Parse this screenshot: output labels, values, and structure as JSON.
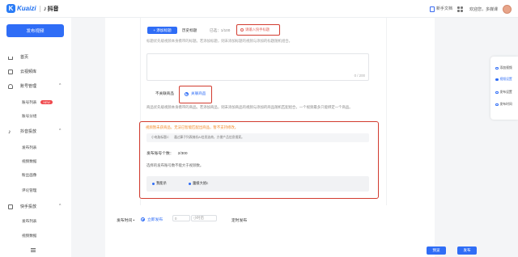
{
  "topbar": {
    "logo_text": "Kuaizi",
    "douyin_text": "抖音",
    "docs_label": "新手文档",
    "welcome_text": "欢迎您，多媒课"
  },
  "sidebar": {
    "publish_button": "发布视频",
    "items": [
      {
        "label": "首页",
        "icon": "home-icon"
      },
      {
        "label": "云视频库",
        "icon": "cloud-icon"
      },
      {
        "label": "账号管理",
        "icon": "user-icon",
        "sub": [
          {
            "label": "账号列表",
            "badge": "NEW"
          },
          {
            "label": "账号分组"
          }
        ]
      },
      {
        "label": "抖音投放",
        "icon": "tiktok-icon",
        "sub": [
          {
            "label": "发布列表"
          },
          {
            "label": "视频数据"
          },
          {
            "label": "粉丝画像"
          },
          {
            "label": "评论管理"
          }
        ]
      },
      {
        "label": "快手投放",
        "icon": "kuaishou-icon",
        "sub": [
          {
            "label": "发布列表"
          },
          {
            "label": "视频数据"
          }
        ]
      }
    ]
  },
  "title_section": {
    "add_tag_button": "+ 添加标题",
    "history_button": "历史标题",
    "selected_label": "已选：",
    "selected_count": "1/100",
    "title_placeholder": "请输入快手标题",
    "description": "标题优先级视频本身携带的标题。若添加标题，则未添加标题的视频与添加的标题随机组合。",
    "counter": "0 / 200"
  },
  "goods_section": {
    "option_none": "不关联商品",
    "option_assoc": "关联商品",
    "description": "商品优先级视频本身携带的商品。若添加商品，则未添加商品的视频与添加的商品随机匹配组合，一个视频最多只能绑定一个商品。",
    "warning": "视频暂未获商品，无法已智能匹配出商品，暂不支持修改。",
    "select_tag": "小电脑标题C",
    "select_text": "通过算子列表随机AI信息选商，方便产品信息搜索。",
    "count_label": "发布账号个数：",
    "count_value": "2/300",
    "account_tip": "选择的发布账号数不能大于视频数。",
    "accounts": [
      "我能杀",
      "蕾娘大姐c"
    ]
  },
  "schedule": {
    "label": "发布时间 •",
    "now_option": "立即发布",
    "input1": "0",
    "input2": "小时后",
    "timed_option": "定时发布"
  },
  "actions": {
    "preview": "预览",
    "publish": "发布"
  },
  "anchor_nav": {
    "items": [
      "添加视频",
      "视频设置",
      "发布设置",
      "发布时间"
    ],
    "active_index": 1
  },
  "colors": {
    "accent": "#2f6df6",
    "highlight_border": "#d23b2f",
    "warning": "#f28b2c"
  }
}
